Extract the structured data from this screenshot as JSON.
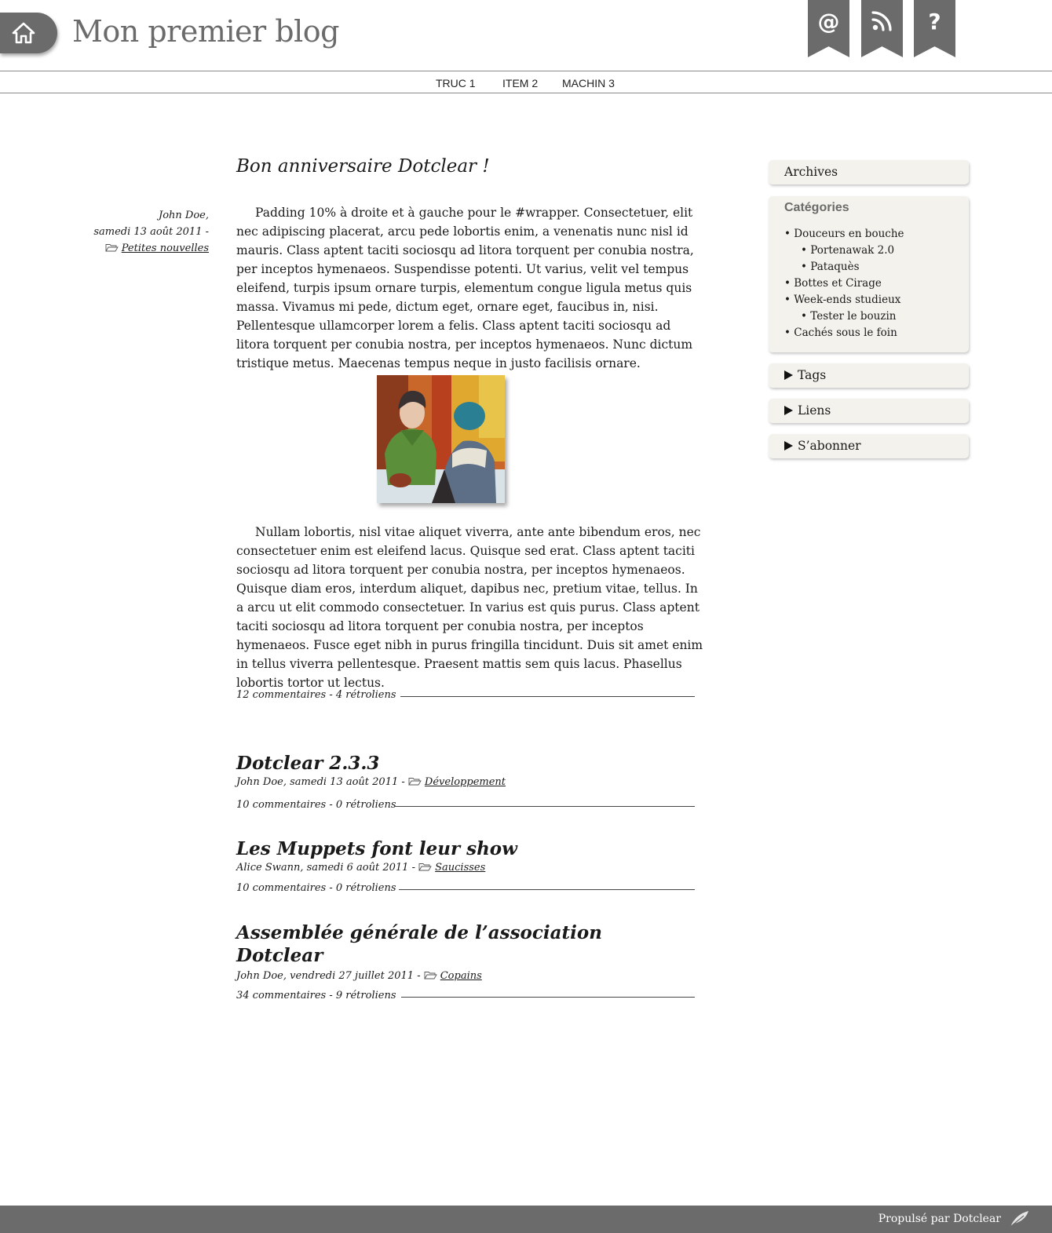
{
  "header": {
    "site_title": "Mon premier blog",
    "home_icon": "home-icon",
    "ribbons": [
      {
        "icon": "at-icon",
        "glyph": "@"
      },
      {
        "icon": "rss-icon",
        "glyph": ""
      },
      {
        "icon": "help-icon",
        "glyph": "?"
      }
    ],
    "colors": {
      "accent": "#6b6b6b",
      "sidebar_bg": "#f3f2ec"
    }
  },
  "nav": {
    "items": [
      {
        "label": "TRUC 1"
      },
      {
        "label": "ITEM 2"
      },
      {
        "label": "MACHIN 3"
      }
    ]
  },
  "main_post": {
    "title": "Bon anniversaire Dotclear !",
    "author": "John Doe,",
    "date": "samedi 13 août 2011 -",
    "category": "Petites nouvelles",
    "paragraph1": "Padding 10% à droite et à gauche pour le #wrapper. Consectetuer, elit nec adipiscing placerat, arcu pede lobortis enim, a venenatis nunc nisl id mauris. Class aptent taciti sociosqu ad litora torquent per conubia nostra, per inceptos hymenaeos. Suspendisse potenti. Ut varius, velit vel tempus eleifend, turpis ipsum ornare turpis, elementum congue ligula metus quis massa. Vivamus mi pede, dictum eget, ornare eget, faucibus in, nisi. Pellentesque ullamcorper lorem a felis. Class aptent taciti sociosqu ad litora torquent per conubia nostra, per inceptos hymenaeos. Nunc dictum tristique metus. Maecenas tempus neque in justo facilisis ornare.",
    "paragraph2": "Nullam lobortis, nisl vitae aliquet viverra, ante ante bibendum eros, nec consectetuer enim est eleifend lacus. Quisque sed erat. Class aptent taciti sociosqu ad litora torquent per conubia nostra, per inceptos hymenaeos. Quisque diam eros, interdum aliquet, dapibus nec, pretium vitae, tellus. In a arcu ut elit commodo consectetuer. In varius est quis purus. Class aptent taciti sociosqu ad litora torquent per conubia nostra, per inceptos hymenaeos. Fusce eget nibh in purus fringilla tincidunt. Duis sit amet enim in tellus viverra pellentesque. Praesent mattis sem quis lacus. Phasellus lobortis tortor ut lectus.",
    "image_icon": "painting-image",
    "footer": "12 commentaires - 4 rétroliens"
  },
  "posts": [
    {
      "title": "Dotclear 2.3.3",
      "meta": "John Doe, samedi 13 août 2011 -",
      "category": "Développement",
      "footer": "10 commentaires - 0 rétroliens"
    },
    {
      "title": "Les Muppets font leur show",
      "meta": "Alice Swann, samedi 6 août 2011 -",
      "category": "Saucisses",
      "footer": "10 commentaires - 0 rétroliens"
    },
    {
      "title_line1": "Assemblée générale de l’association",
      "title_line2": "Dotclear",
      "meta": "John Doe, vendredi 27 juillet 2011 -",
      "category": "Copains",
      "footer": "34 commentaires - 9 rétroliens"
    }
  ],
  "sidebar": {
    "archives": "Archives",
    "categories_title": "Catégories",
    "categories": [
      {
        "label": "Douceurs en bouche",
        "level": 1
      },
      {
        "label": "Portenawak 2.0",
        "level": 2
      },
      {
        "label": "Pataquès",
        "level": 2
      },
      {
        "label": "Bottes et Cirage",
        "level": 1
      },
      {
        "label": "Week-ends studieux",
        "level": 1
      },
      {
        "label": "Tester le bouzin",
        "level": 2
      },
      {
        "label": "Cachés sous le foin",
        "level": 1
      }
    ],
    "tags": "Tags",
    "links": "Liens",
    "subscribe": "S’abonner"
  },
  "footer": {
    "text": "Propulsé par Dotclear",
    "icon": "feather-icon"
  }
}
